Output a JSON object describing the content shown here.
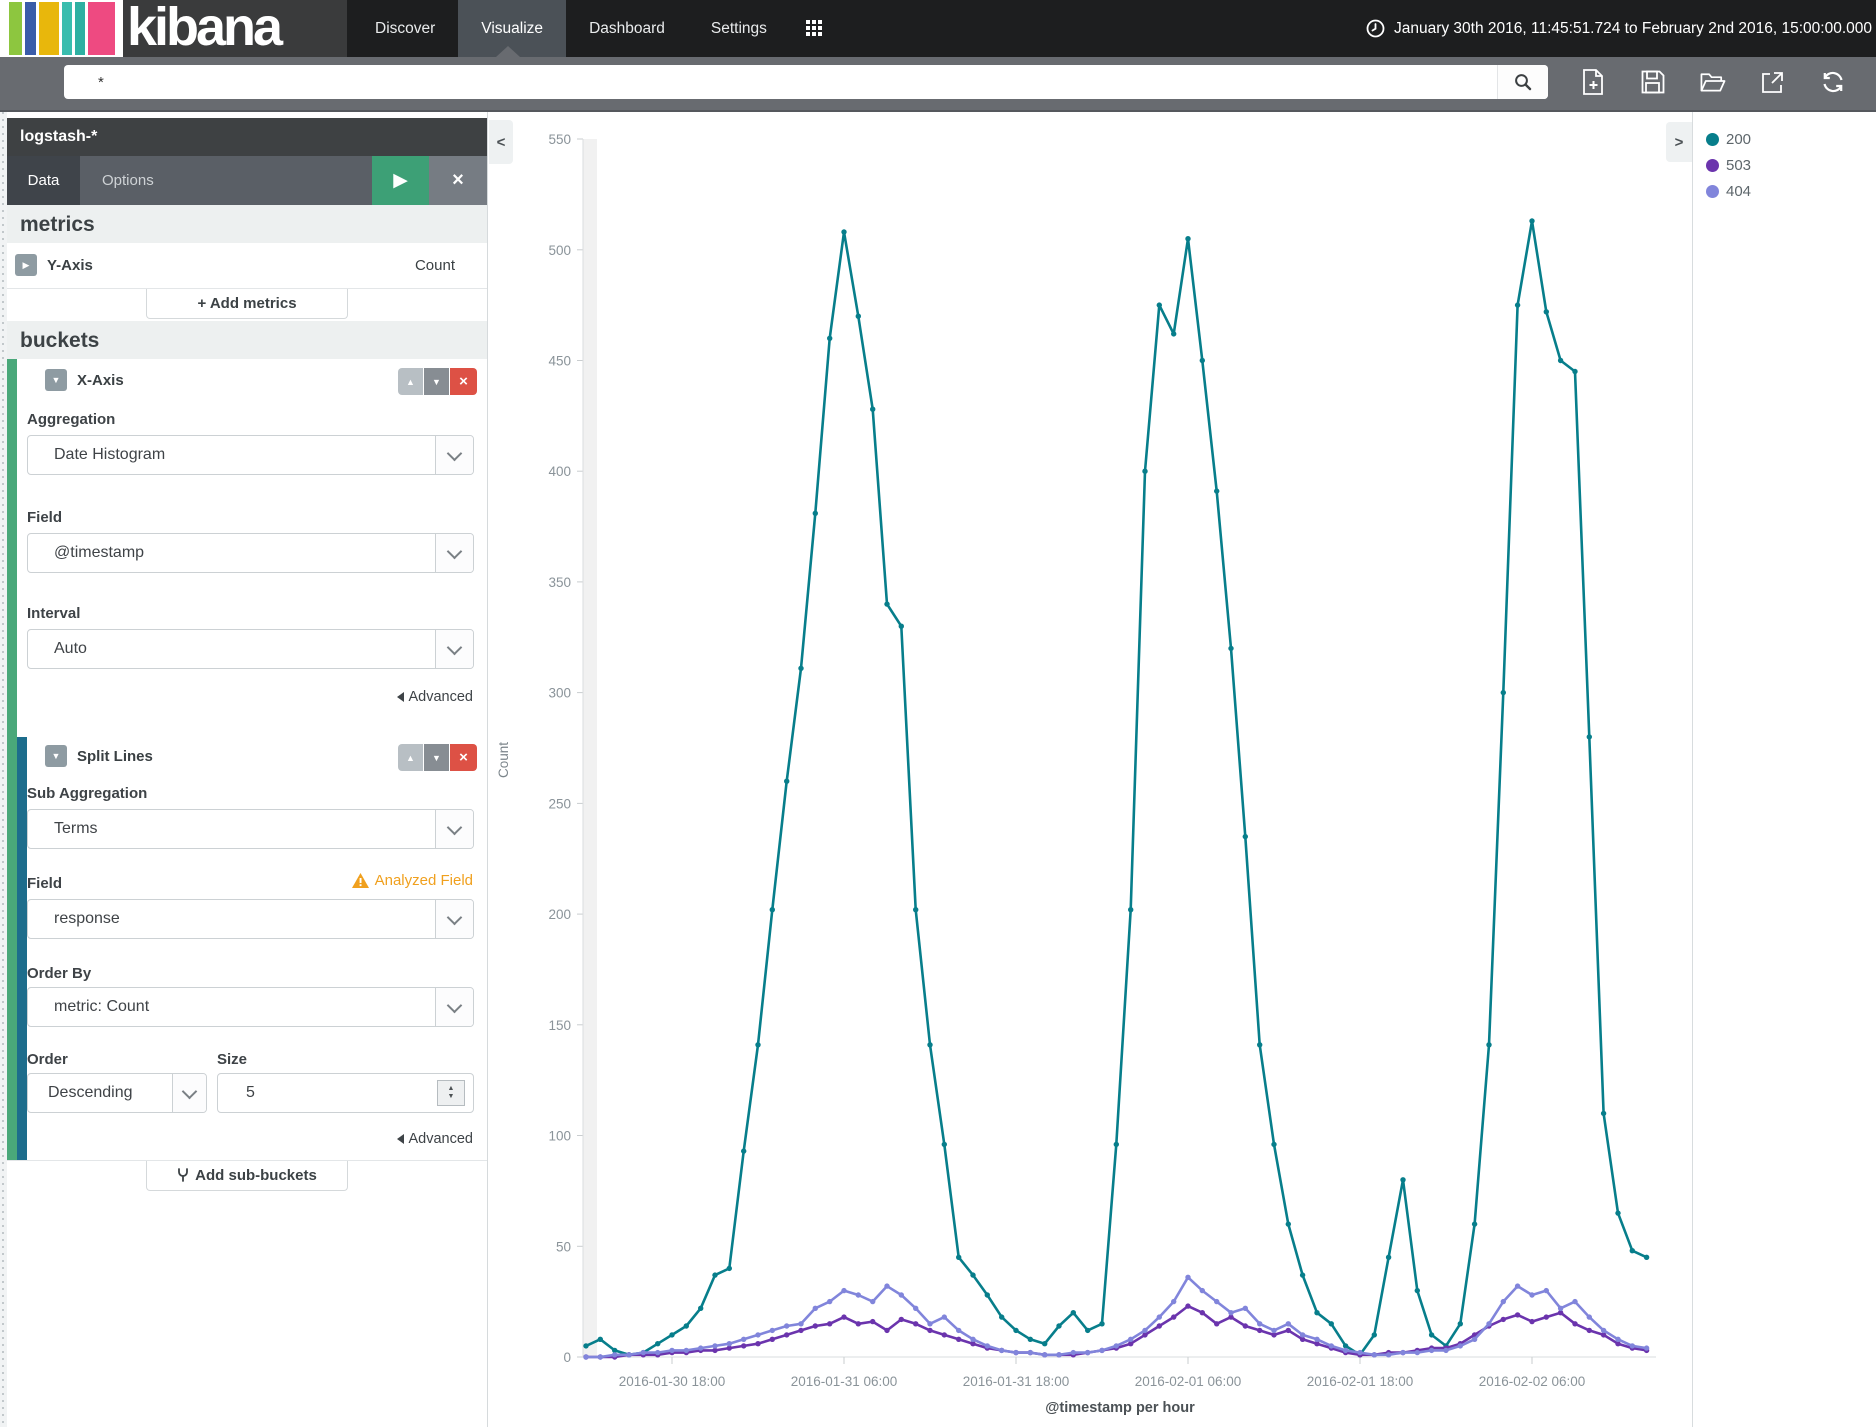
{
  "nav": {
    "brand": "kibana",
    "logo_stripe_colors": [
      "#8dc63f",
      "#3a5ca9",
      "#e8b70c",
      "#39bdae",
      "#2eb0a2",
      "#ee4a81"
    ],
    "items": [
      {
        "label": "Discover",
        "active": false
      },
      {
        "label": "Visualize",
        "active": true
      },
      {
        "label": "Dashboard",
        "active": false
      },
      {
        "label": "Settings",
        "active": false
      }
    ],
    "time_range": "January 30th 2016, 11:45:51.724 to February 2nd 2016, 15:00:00.000"
  },
  "search": {
    "value": "*"
  },
  "icons": {
    "play": "▶",
    "close": "×",
    "collapse_open": "▼",
    "collapse_closed": "▶",
    "up": "▲",
    "down": "▼",
    "remove": "×",
    "spin_up": "▲",
    "spin_down": "▼",
    "add": "+",
    "sidebar_collapse": "<",
    "legend_collapse": ">"
  },
  "sidebar": {
    "index_pattern": "logstash-*",
    "tabs": [
      {
        "label": "Data",
        "active": true
      },
      {
        "label": "Options",
        "active": false
      }
    ],
    "metrics": {
      "heading": "metrics",
      "y_axis_label": "Y-Axis",
      "y_axis_value": "Count",
      "add_button": "Add metrics"
    },
    "buckets": {
      "heading": "buckets",
      "x_axis": {
        "title": "X-Axis",
        "aggregation_label": "Aggregation",
        "aggregation_value": "Date Histogram",
        "field_label": "Field",
        "field_value": "@timestamp",
        "interval_label": "Interval",
        "interval_value": "Auto",
        "advanced": "Advanced"
      },
      "split_lines": {
        "title": "Split Lines",
        "sub_aggregation_label": "Sub Aggregation",
        "sub_aggregation_value": "Terms",
        "field_label": "Field",
        "field_warning": "Analyzed Field",
        "field_value": "response",
        "order_by_label": "Order By",
        "order_by_value": "metric: Count",
        "order_label": "Order",
        "order_value": "Descending",
        "size_label": "Size",
        "size_value": "5",
        "advanced": "Advanced"
      },
      "add_button": "Add sub-buckets"
    }
  },
  "chart_data": {
    "type": "line",
    "xlabel": "@timestamp per hour",
    "ylabel": "Count",
    "ylim": [
      0,
      550
    ],
    "y_ticks": [
      0,
      50,
      100,
      150,
      200,
      250,
      300,
      350,
      400,
      450,
      500,
      550
    ],
    "grid": false,
    "legend_position": "right",
    "x_start": "2016-01-30 12:00",
    "x_interval_hours": 1,
    "x_tick_labels": [
      "2016-01-30 18:00",
      "2016-01-31 06:00",
      "2016-01-31 18:00",
      "2016-02-01 06:00",
      "2016-02-01 18:00",
      "2016-02-02 06:00"
    ],
    "x_tick_indices": [
      6,
      18,
      30,
      42,
      54,
      66
    ],
    "series": [
      {
        "name": "200",
        "color": "#077e8b",
        "values": [
          5,
          8,
          3,
          1,
          2,
          6,
          10,
          14,
          22,
          37,
          40,
          93,
          141,
          202,
          260,
          311,
          381,
          460,
          508,
          470,
          428,
          340,
          330,
          202,
          141,
          96,
          45,
          37,
          28,
          18,
          12,
          8,
          6,
          14,
          20,
          12,
          15,
          96,
          202,
          400,
          475,
          462,
          505,
          450,
          391,
          320,
          235,
          141,
          96,
          60,
          37,
          20,
          15,
          5,
          1,
          10,
          45,
          80,
          30,
          10,
          5,
          15,
          60,
          141,
          300,
          475,
          513,
          472,
          450,
          445,
          280,
          110,
          65,
          48,
          45
        ]
      },
      {
        "name": "503",
        "color": "#6b34ad",
        "values": [
          0,
          0,
          0,
          1,
          1,
          1,
          2,
          2,
          3,
          3,
          4,
          5,
          6,
          8,
          10,
          12,
          14,
          15,
          18,
          15,
          16,
          12,
          17,
          15,
          12,
          10,
          8,
          6,
          4,
          3,
          2,
          2,
          1,
          1,
          1,
          2,
          3,
          4,
          6,
          10,
          14,
          18,
          23,
          20,
          15,
          18,
          14,
          12,
          10,
          12,
          8,
          6,
          4,
          2,
          1,
          1,
          2,
          2,
          3,
          4,
          4,
          6,
          10,
          14,
          17,
          19,
          16,
          18,
          20,
          15,
          12,
          10,
          6,
          4,
          3
        ]
      },
      {
        "name": "404",
        "color": "#8185db",
        "values": [
          0,
          0,
          1,
          1,
          2,
          2,
          3,
          3,
          4,
          5,
          6,
          8,
          10,
          12,
          14,
          15,
          22,
          25,
          30,
          28,
          25,
          32,
          28,
          22,
          15,
          18,
          12,
          8,
          5,
          3,
          2,
          2,
          1,
          1,
          2,
          2,
          3,
          5,
          8,
          12,
          18,
          25,
          36,
          30,
          25,
          20,
          22,
          15,
          12,
          15,
          10,
          8,
          5,
          3,
          2,
          1,
          1,
          2,
          2,
          3,
          3,
          5,
          8,
          15,
          25,
          32,
          28,
          30,
          22,
          25,
          18,
          12,
          8,
          5,
          4
        ]
      }
    ]
  },
  "legend": {
    "items": [
      {
        "label": "200",
        "color": "#077e8b"
      },
      {
        "label": "503",
        "color": "#6b34ad"
      },
      {
        "label": "404",
        "color": "#8185db"
      }
    ]
  }
}
